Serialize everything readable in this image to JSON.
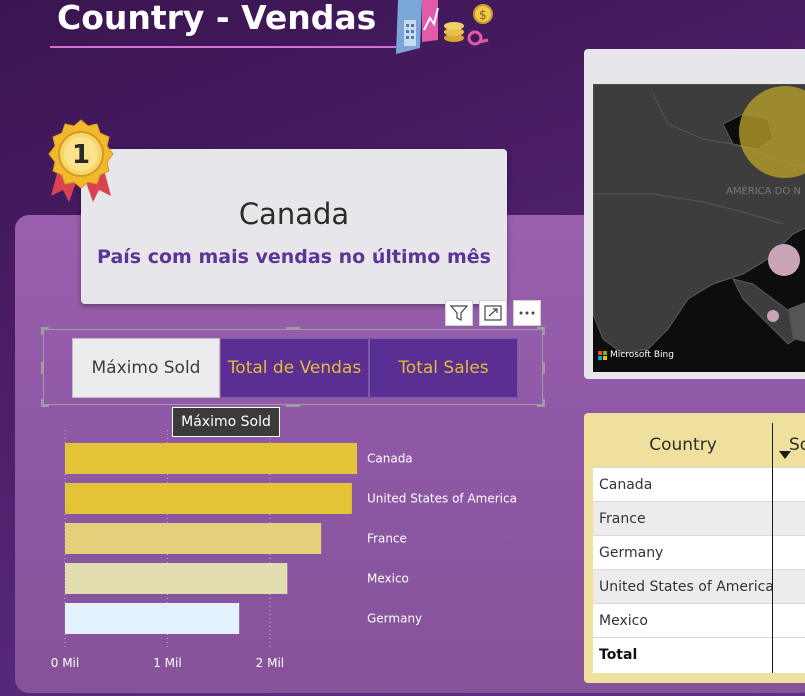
{
  "header": {
    "title": "Country - Vendas"
  },
  "top_card": {
    "country": "Canada",
    "subtitle": "País com mais vendas no último mês",
    "medal_number": "1"
  },
  "visual_header": {
    "filter_icon": "filter-icon",
    "focus_icon": "focus-mode-icon",
    "more_icon": "more-options-icon"
  },
  "slicer": {
    "tabs": [
      {
        "label": "Máximo Sold",
        "active": true
      },
      {
        "label": "Total de Vendas",
        "active": false
      },
      {
        "label": "Total Sales",
        "active": false
      }
    ]
  },
  "tooltip": {
    "text": "Máximo Sold"
  },
  "chart_data": {
    "type": "bar",
    "orientation": "horizontal",
    "categories": [
      "Canada",
      "United States of America",
      "France",
      "Mexico",
      "Germany"
    ],
    "values": [
      2.85,
      2.8,
      2.5,
      2.17,
      1.7
    ],
    "colors": [
      "#e4c436",
      "#e4c436",
      "#e4d07a",
      "#e1ddae",
      "#e2f1fb"
    ],
    "x_ticks": [
      "0 Mil",
      "1 Mil",
      "2 Mil"
    ],
    "xlim": [
      0,
      2.85
    ],
    "grid": true
  },
  "map": {
    "attribution": "Microsoft Bing",
    "label": "AMÉRICA DO N"
  },
  "table": {
    "headers": [
      "Country",
      "So"
    ],
    "rows": [
      "Canada",
      "France",
      "Germany",
      "United States of America",
      "Mexico"
    ],
    "total_label": "Total"
  },
  "colors": {
    "accent_gold": "#e4c436",
    "accent_purple": "#5a2f93"
  }
}
